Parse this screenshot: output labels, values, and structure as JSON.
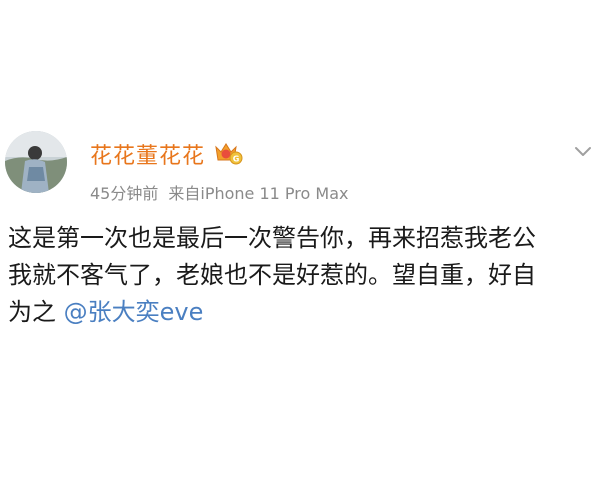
{
  "post": {
    "author": "花花董花花",
    "time_ago": "45分钟前",
    "source_prefix": "来自",
    "source_device": "iPhone 11 Pro Max",
    "body_lines": [
      "这是第一次也是最后一次警告你，再来招惹我老公",
      "我就不客气了，老娘也不是好惹的。望自重，好自",
      "为之 "
    ],
    "mention": "@张大奕eve"
  },
  "icons": {
    "avatar": "user-avatar-photo",
    "badge": "vip-membership-badge",
    "menu": "chevron-down-icon"
  },
  "colors": {
    "author_name": "#e8761c",
    "meta_text": "#8a8a8a",
    "mention": "#4a7fc1",
    "body_text": "#1a1a1a"
  }
}
